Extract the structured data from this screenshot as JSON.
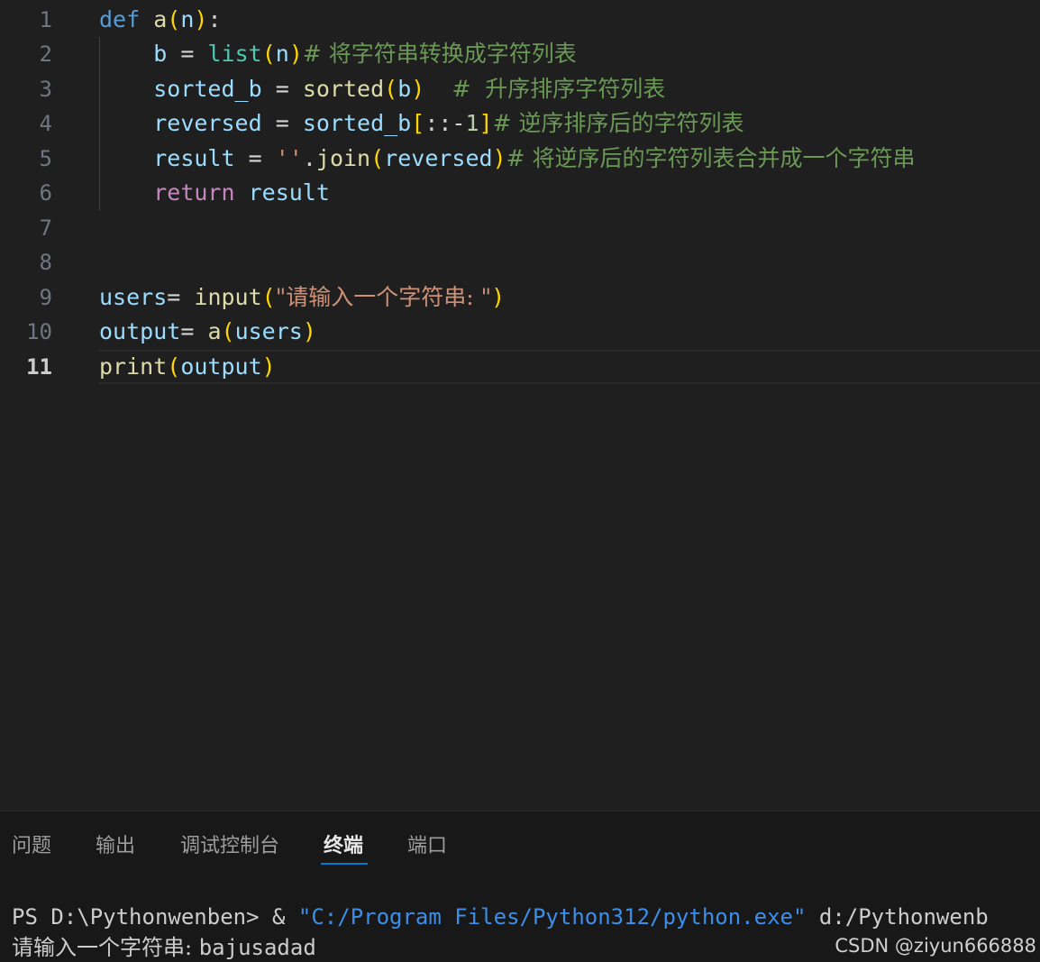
{
  "editor": {
    "line_numbers": [
      "1",
      "2",
      "3",
      "4",
      "5",
      "6",
      "7",
      "8",
      "9",
      "10",
      "11"
    ],
    "active_line": "11",
    "code": {
      "l1": {
        "def": "def",
        "name": "a",
        "param": "n"
      },
      "l2": {
        "var": "b",
        "fn": "list",
        "arg": "n",
        "comment": "# 将字符串转换成字符列表"
      },
      "l3": {
        "var": "sorted_b",
        "fn": "sorted",
        "arg": "b",
        "comment": "#  升序排序字符列表"
      },
      "l4": {
        "var": "reversed",
        "obj": "sorted_b",
        "slice": "::-1",
        "comment": "# 逆序排序后的字符列表"
      },
      "l5": {
        "var": "result",
        "str": "''",
        "method": "join",
        "arg": "reversed",
        "comment": "# 将逆序后的字符列表合并成一个字符串"
      },
      "l6": {
        "kw": "return",
        "var": "result"
      },
      "l9": {
        "var": "users",
        "fn": "input",
        "str": "\"请输入一个字符串: \""
      },
      "l10": {
        "var": "output",
        "fn": "a",
        "arg": "users"
      },
      "l11": {
        "fn": "print",
        "arg": "output"
      }
    }
  },
  "panel": {
    "tabs": [
      "问题",
      "输出",
      "调试控制台",
      "终端",
      "端口"
    ],
    "active_tab": "终端",
    "terminal": {
      "prompt": "PS D:\\Pythonwenben> ",
      "amp": "& ",
      "exe": "\"C:/Program Files/Python312/python.exe\"",
      "script": " d:/Pythonwenb",
      "input_prompt": "请输入一个字符串: ",
      "input_value": "bajusadad"
    }
  },
  "watermark": "CSDN @ziyun666888"
}
